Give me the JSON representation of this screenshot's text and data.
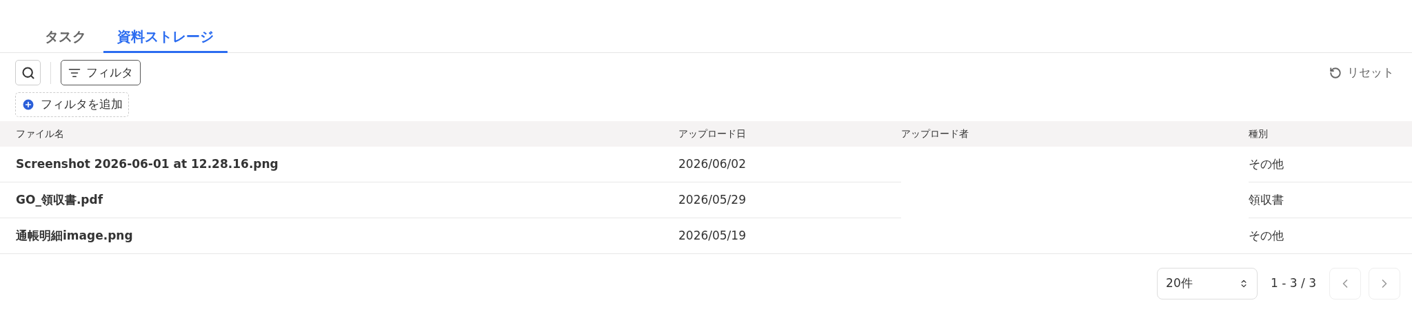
{
  "tabs": [
    {
      "label": "タスク",
      "selected": false
    },
    {
      "label": "資料ストレージ",
      "selected": true
    }
  ],
  "toolbar": {
    "filter_button": "フィルタ",
    "reset_button": "リセット",
    "add_filter_button": "フィルタを追加"
  },
  "table": {
    "columns": [
      "ファイル名",
      "アップロード日",
      "アップロード者",
      "種別"
    ],
    "rows": [
      {
        "file_name": "Screenshot 2026-06-01 at 12.28.16.png",
        "upload_date": "2026/06/02",
        "type": "その他"
      },
      {
        "file_name": "GO_領収書.pdf",
        "upload_date": "2026/05/29",
        "type": "領収書"
      },
      {
        "file_name": "通帳明細image.png",
        "upload_date": "2026/05/19",
        "type": "その他"
      }
    ]
  },
  "pagination": {
    "page_size": "20件",
    "range": "1 - 3 / 3"
  }
}
